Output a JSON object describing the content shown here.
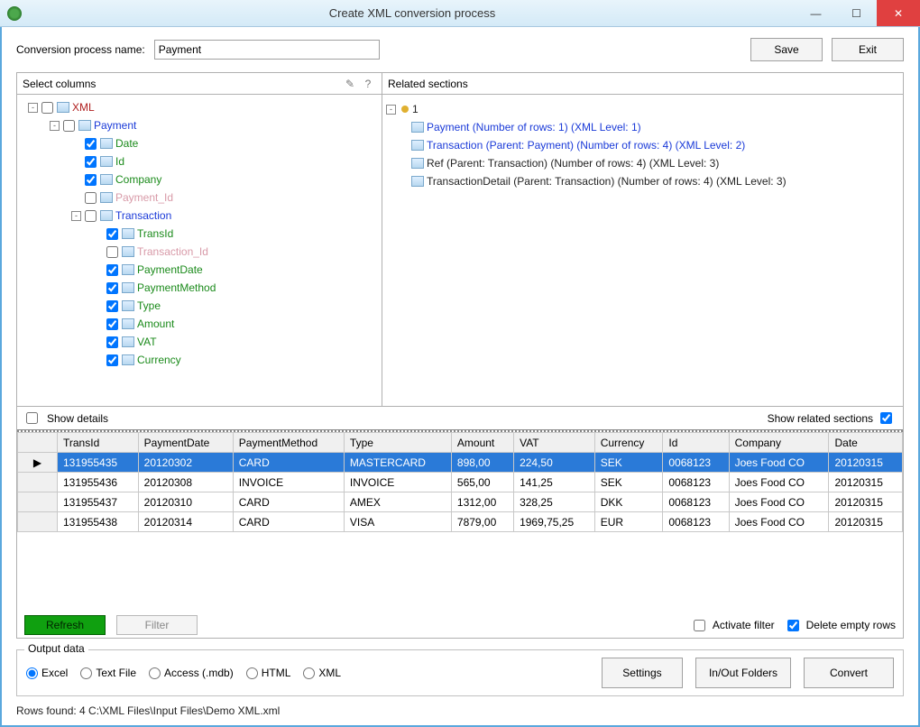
{
  "window": {
    "title": "Create XML conversion process"
  },
  "toolbar": {
    "name_label": "Conversion process name:",
    "name_value": "Payment",
    "save_label": "Save",
    "exit_label": "Exit"
  },
  "left_header": "Select columns",
  "right_header": "Related sections",
  "tree": [
    {
      "depth": 0,
      "expander": "-",
      "checked": false,
      "label": "XML",
      "cls": "c-root"
    },
    {
      "depth": 1,
      "expander": "-",
      "checked": false,
      "label": "Payment",
      "cls": "c-blue"
    },
    {
      "depth": 2,
      "expander": "",
      "checked": true,
      "label": "Date",
      "cls": "c-green"
    },
    {
      "depth": 2,
      "expander": "",
      "checked": true,
      "label": "Id",
      "cls": "c-green"
    },
    {
      "depth": 2,
      "expander": "",
      "checked": true,
      "label": "Company",
      "cls": "c-green"
    },
    {
      "depth": 2,
      "expander": "",
      "checked": false,
      "label": "Payment_Id",
      "cls": "c-pink"
    },
    {
      "depth": 2,
      "expander": "-",
      "checked": false,
      "label": "Transaction",
      "cls": "c-blue"
    },
    {
      "depth": 3,
      "expander": "",
      "checked": true,
      "label": "TransId",
      "cls": "c-green"
    },
    {
      "depth": 3,
      "expander": "",
      "checked": false,
      "label": "Transaction_Id",
      "cls": "c-pink"
    },
    {
      "depth": 3,
      "expander": "",
      "checked": true,
      "label": "PaymentDate",
      "cls": "c-green"
    },
    {
      "depth": 3,
      "expander": "",
      "checked": true,
      "label": "PaymentMethod",
      "cls": "c-green"
    },
    {
      "depth": 3,
      "expander": "",
      "checked": true,
      "label": "Type",
      "cls": "c-green"
    },
    {
      "depth": 3,
      "expander": "",
      "checked": true,
      "label": "Amount",
      "cls": "c-green"
    },
    {
      "depth": 3,
      "expander": "",
      "checked": true,
      "label": "VAT",
      "cls": "c-green"
    },
    {
      "depth": 3,
      "expander": "",
      "checked": true,
      "label": "Currency",
      "cls": "c-green"
    }
  ],
  "related_root": "1",
  "related": [
    {
      "depth": 1,
      "label": "Payment (Number of rows: 1) (XML Level: 1)",
      "blue": true
    },
    {
      "depth": 1,
      "label": "Transaction (Parent: Payment) (Number of rows: 4) (XML Level: 2)",
      "blue": true
    },
    {
      "depth": 1,
      "label": "Ref (Parent: Transaction) (Number of rows: 4) (XML Level: 3)",
      "blue": false
    },
    {
      "depth": 1,
      "label": "TransactionDetail (Parent: Transaction) (Number of rows: 4) (XML Level: 3)",
      "blue": false
    }
  ],
  "opts": {
    "show_details": "Show details",
    "show_related": "Show related sections"
  },
  "table": {
    "headers": [
      "TransId",
      "PaymentDate",
      "PaymentMethod",
      "Type",
      "Amount",
      "VAT",
      "Currency",
      "Id",
      "Company",
      "Date"
    ],
    "rows": [
      [
        "131955435",
        "20120302",
        "CARD",
        "MASTERCARD",
        "898,00",
        "224,50",
        "SEK",
        "0068123",
        "Joes Food CO",
        "20120315"
      ],
      [
        "131955436",
        "20120308",
        "INVOICE",
        "INVOICE",
        "565,00",
        "141,25",
        "SEK",
        "0068123",
        "Joes Food CO",
        "20120315"
      ],
      [
        "131955437",
        "20120310",
        "CARD",
        "AMEX",
        "1312,00",
        "328,25",
        "DKK",
        "0068123",
        "Joes Food CO",
        "20120315"
      ],
      [
        "131955438",
        "20120314",
        "CARD",
        "VISA",
        "7879,00",
        "1969,75,25",
        "EUR",
        "0068123",
        "Joes Food CO",
        "20120315"
      ]
    ],
    "selected_row": 0
  },
  "tablebar": {
    "refresh": "Refresh",
    "filter": "Filter",
    "activate_filter": "Activate filter",
    "delete_empty": "Delete empty rows"
  },
  "output": {
    "legend": "Output data",
    "radios": [
      "Excel",
      "Text File",
      "Access (.mdb)",
      "HTML",
      "XML"
    ],
    "selected": "Excel",
    "settings": "Settings",
    "folders": "In/Out Folders",
    "convert": "Convert"
  },
  "status": "Rows found: 4  C:\\XML Files\\Input Files\\Demo XML.xml"
}
